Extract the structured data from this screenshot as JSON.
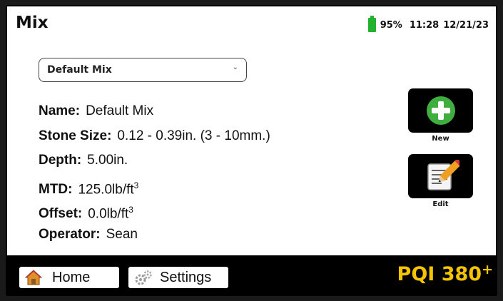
{
  "header": {
    "title": "Mix",
    "battery_percent": "95%",
    "battery_level": 0.95,
    "time": "11:28",
    "date": "12/21/23"
  },
  "mix_select": {
    "selected": "Default Mix",
    "icon": "chevron-down-icon"
  },
  "fields": [
    {
      "label": "Name:",
      "value": "Default Mix",
      "unit_sup": ""
    },
    {
      "label": "Stone Size:",
      "value": "0.12 - 0.39in. (3 - 10mm.)",
      "unit_sup": ""
    },
    {
      "label": "Depth:",
      "value": "5.00in.",
      "unit_sup": ""
    },
    {
      "label": "MTD:",
      "value": "125.0lb/ft",
      "unit_sup": "3"
    },
    {
      "label": "Offset:",
      "value": "0.0lb/ft",
      "unit_sup": "3"
    },
    {
      "label": "Operator:",
      "value": "Sean",
      "unit_sup": ""
    }
  ],
  "actions": {
    "new": {
      "label": "New",
      "icon": "plus-icon",
      "color": "#3fae3f"
    },
    "edit": {
      "label": "Edit",
      "icon": "edit-note-icon"
    }
  },
  "bottom_nav": {
    "home": {
      "label": "Home",
      "icon": "home-icon"
    },
    "settings": {
      "label": "Settings",
      "icon": "gears-icon"
    }
  },
  "brand": {
    "name": "PQI 380",
    "sup": "+",
    "color": "#f5c400"
  }
}
